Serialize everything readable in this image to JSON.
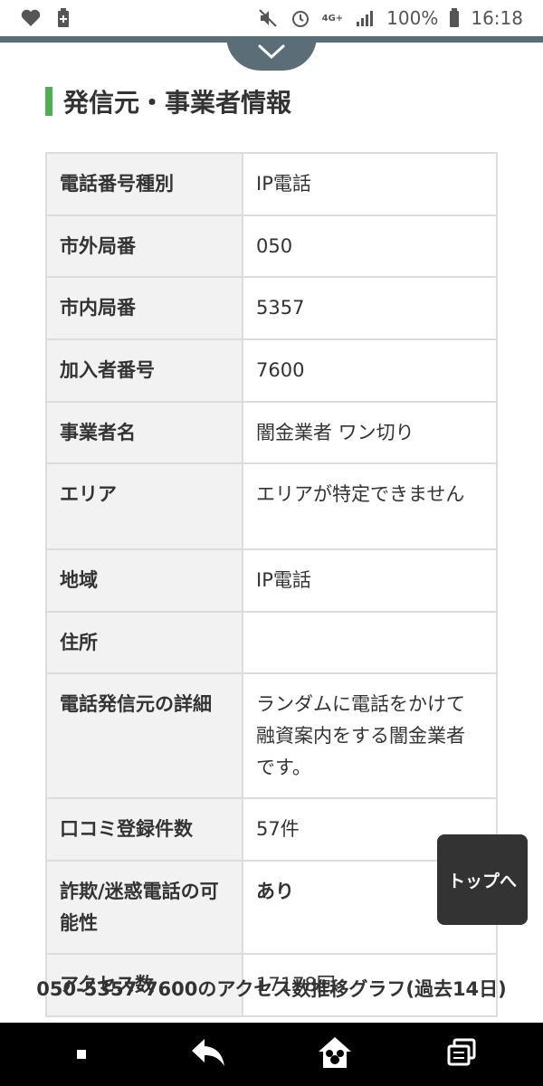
{
  "status_bar": {
    "battery": "100%",
    "time": "16:18",
    "network": "4G+"
  },
  "section": {
    "title": "発信元・事業者情報"
  },
  "rows": [
    {
      "label": "電話番号種別",
      "value": "IP電話"
    },
    {
      "label": "市外局番",
      "value": "050"
    },
    {
      "label": "市内局番",
      "value": "5357"
    },
    {
      "label": "加入者番号",
      "value": "7600"
    },
    {
      "label": "事業者名",
      "value": "闇金業者 ワン切り"
    },
    {
      "label": "エリア",
      "value": "エリアが特定できません"
    },
    {
      "label": "地域",
      "value": "IP電話"
    },
    {
      "label": "住所",
      "value": ""
    },
    {
      "label": "電話発信元の詳細",
      "value": "ランダムに電話をかけて融資案内をする闇金業者です。"
    },
    {
      "label": "口コミ登録件数",
      "value": "57件"
    },
    {
      "label": "詐欺/迷惑電話の可能性",
      "value": "あり"
    },
    {
      "label": "アクセス数",
      "value": "17178回"
    }
  ],
  "graph": {
    "title": "050-5357-7600のアクセス数推移グラフ(過去14日)"
  },
  "top_button": {
    "label": "トップへ"
  },
  "colors": {
    "accent_green": "#4caf50",
    "header_band": "#5b6e78",
    "danger_red": "#e00000"
  }
}
